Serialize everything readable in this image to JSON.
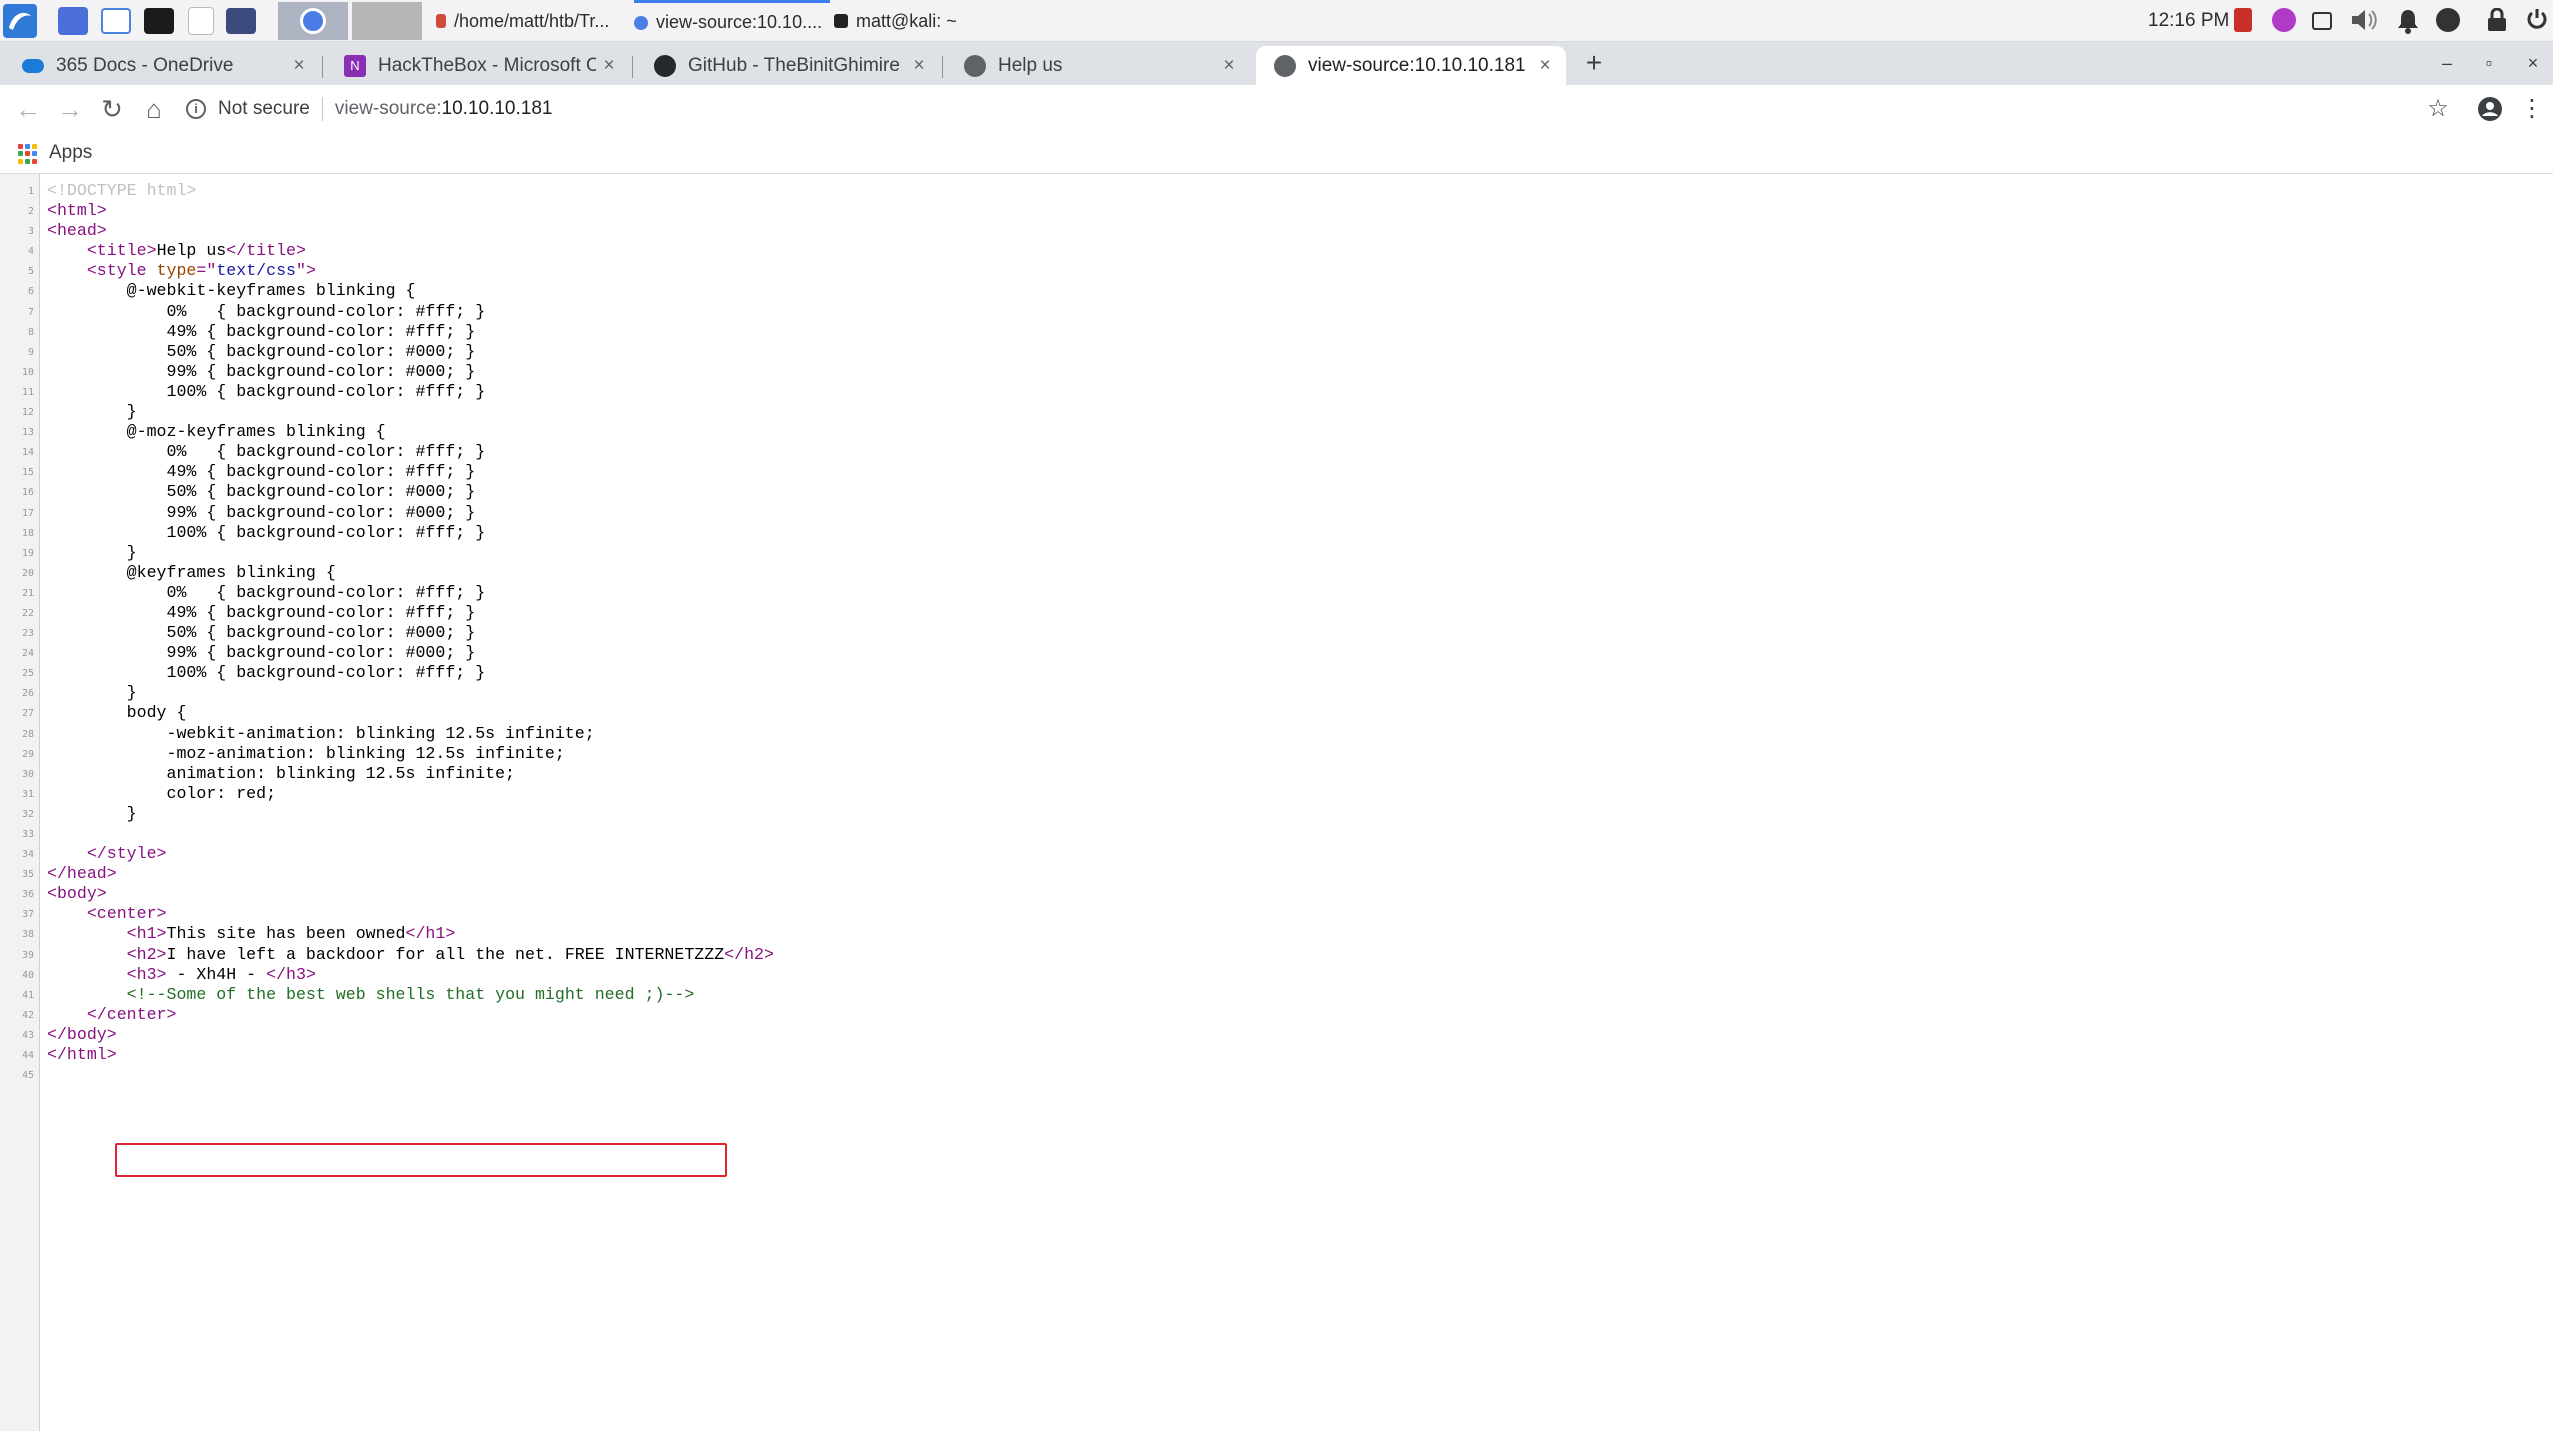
{
  "taskbar": {
    "tasks": [
      {
        "label": "/home/matt/htb/Tr..."
      },
      {
        "label": "view-source:10.10...."
      },
      {
        "label": "matt@kali: ~"
      }
    ],
    "clock": "12:16 PM"
  },
  "tabs": [
    {
      "label": "365 Docs - OneDrive",
      "close": "×",
      "icon": "onedrive-icon"
    },
    {
      "label": "HackTheBox - Microsoft O",
      "close": "×",
      "icon": "onenote-icon"
    },
    {
      "label": "GitHub - TheBinitGhimire",
      "close": "×",
      "icon": "github-icon"
    },
    {
      "label": "Help us",
      "close": "×",
      "icon": "globe-icon"
    },
    {
      "label": "view-source:10.10.10.181",
      "close": "×",
      "icon": "globe-icon"
    }
  ],
  "toolbar": {
    "security_label": "Not secure",
    "url_scheme": "view-source:",
    "url_host": "10.10.10.181"
  },
  "bookmarks": {
    "apps_label": "Apps"
  },
  "source_lines": [
    "<!DOCTYPE html>",
    "<html>",
    "<head>",
    "    <title>Help us</title>",
    "    <style type=\"text/css\">",
    "        @-webkit-keyframes blinking {",
    "            0%   { background-color: #fff; }",
    "            49% { background-color: #fff; }",
    "            50% { background-color: #000; }",
    "            99% { background-color: #000; }",
    "            100% { background-color: #fff; }",
    "        }",
    "        @-moz-keyframes blinking {",
    "            0%   { background-color: #fff; }",
    "            49% { background-color: #fff; }",
    "            50% { background-color: #000; }",
    "            99% { background-color: #000; }",
    "            100% { background-color: #fff; }",
    "        }",
    "        @keyframes blinking {",
    "            0%   { background-color: #fff; }",
    "            49% { background-color: #fff; }",
    "            50% { background-color: #000; }",
    "            99% { background-color: #000; }",
    "            100% { background-color: #fff; }",
    "        }",
    "        body {",
    "            -webkit-animation: blinking 12.5s infinite;",
    "            -moz-animation: blinking 12.5s infinite;",
    "            animation: blinking 12.5s infinite;",
    "            color: red;",
    "        }",
    "",
    "    </style>",
    "</head>",
    "<body>",
    "    <center>",
    "        <h1>This site has been owned</h1>",
    "        <h2>I have left a backdoor for all the net. FREE INTERNETZZZ</h2>",
    "        <h3> - Xh4H - </h3>",
    "        <!--Some of the best web shells that you might need ;)-->",
    "    </center>",
    "</body>",
    "</html>",
    ""
  ],
  "colors": {
    "tag": "#881280",
    "attribute_name": "#994500",
    "attribute_value": "#1a1aa6",
    "comment": "#236e25",
    "doctype": "#c0c0c0",
    "highlight_box": "#e0242c",
    "tabstrip": "#dee1e6"
  }
}
